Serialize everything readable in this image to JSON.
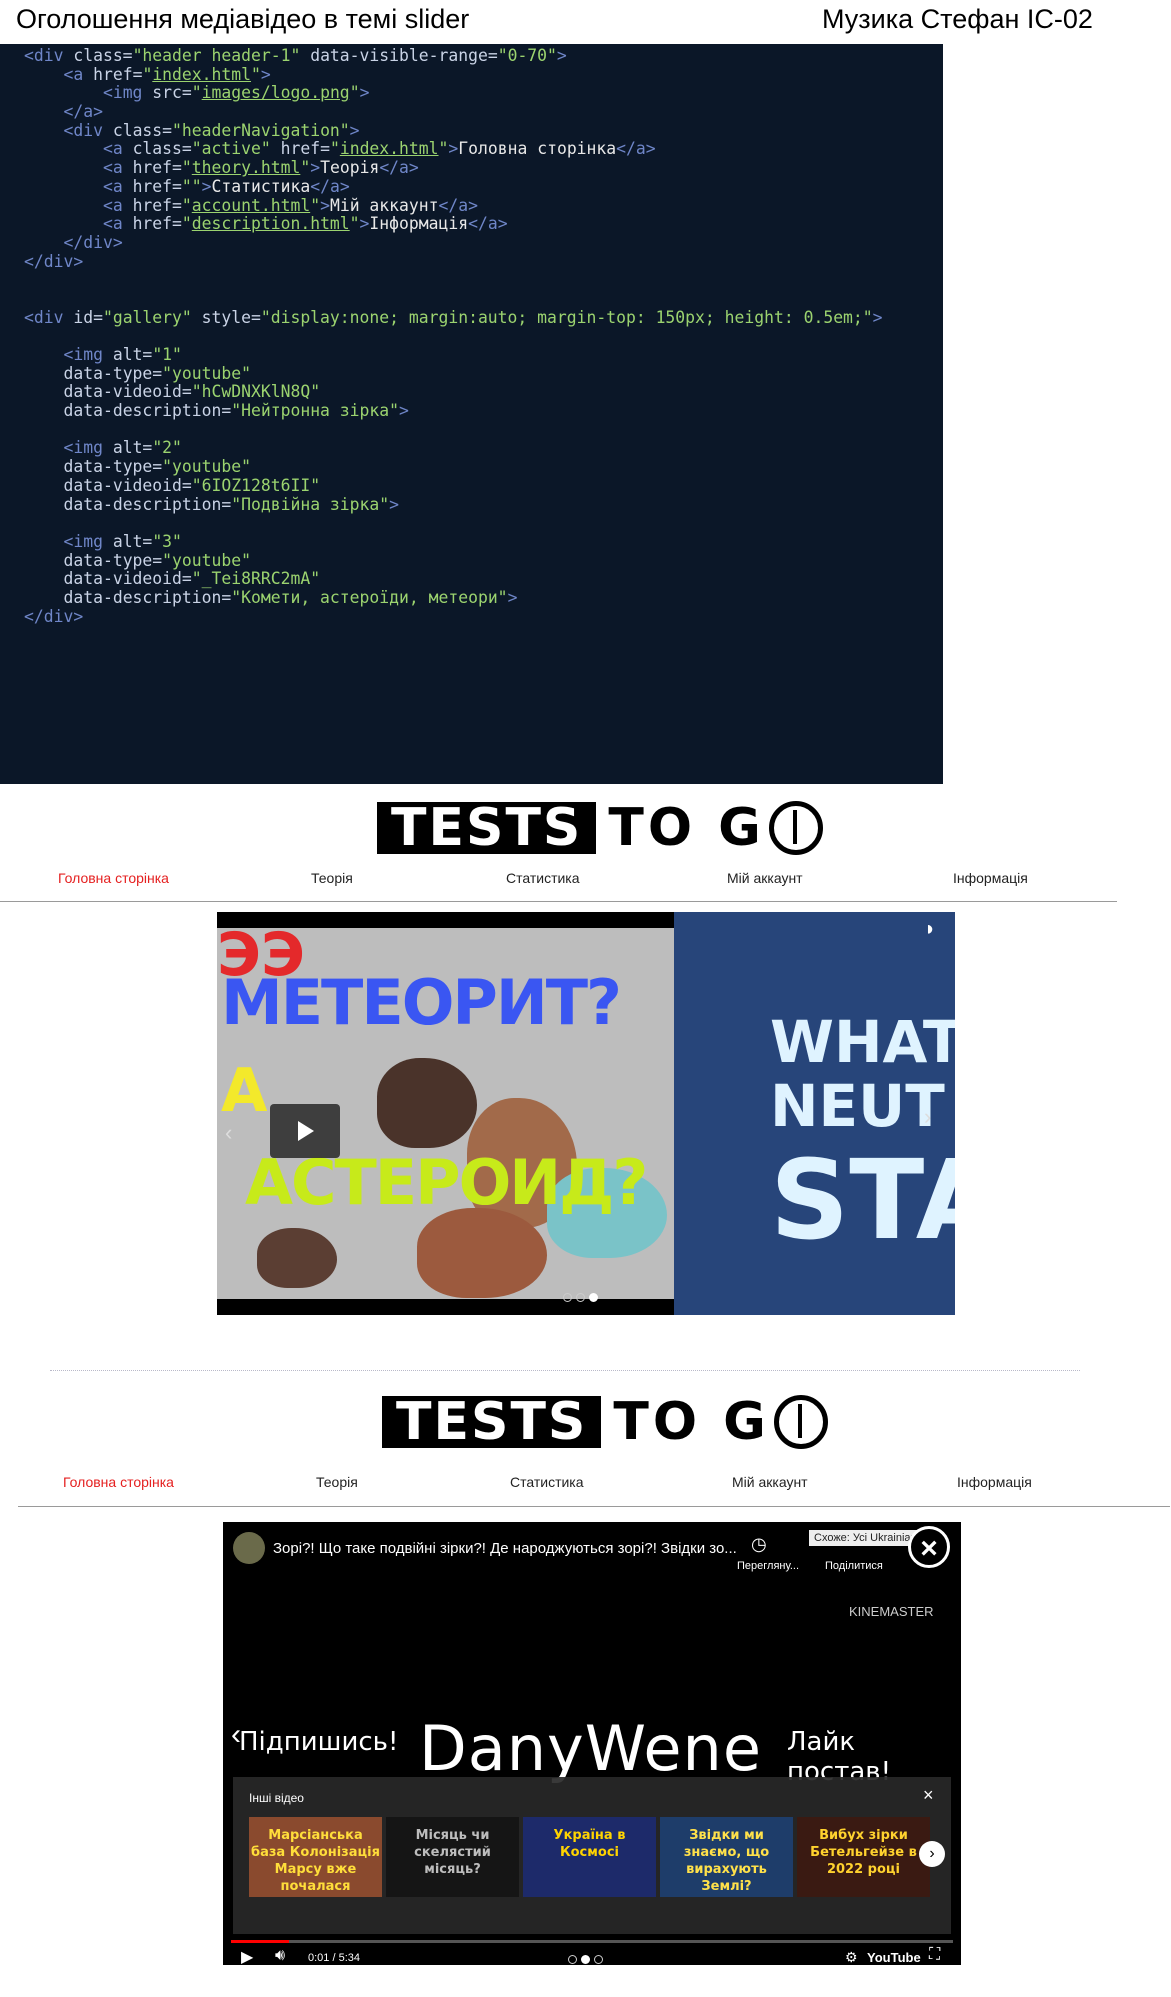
{
  "caption": {
    "title": "Оголошення медіавідео в темі slider",
    "author": "Музика Стефан",
    "group": "ІС-02"
  },
  "code": {
    "lines": [
      [
        [
          "tag",
          "<div "
        ],
        [
          "attr",
          "class="
        ],
        [
          "str",
          "\"header header-1\""
        ],
        [
          "attr",
          " data-visible-range="
        ],
        [
          "str",
          "\"0-70\""
        ],
        [
          "tag",
          ">"
        ]
      ],
      [
        [
          "txt",
          "    "
        ],
        [
          "tag",
          "<a "
        ],
        [
          "attr",
          "href="
        ],
        [
          "str",
          "\""
        ],
        [
          "link",
          "index.html"
        ],
        [
          "str",
          "\""
        ],
        [
          "tag",
          ">"
        ]
      ],
      [
        [
          "txt",
          "        "
        ],
        [
          "tag",
          "<img "
        ],
        [
          "attr",
          "src="
        ],
        [
          "str",
          "\""
        ],
        [
          "link",
          "images/logo.png"
        ],
        [
          "str",
          "\""
        ],
        [
          "tag",
          ">"
        ]
      ],
      [
        [
          "txt",
          "    "
        ],
        [
          "tag",
          "</a>"
        ]
      ],
      [
        [
          "txt",
          "    "
        ],
        [
          "tag",
          "<div "
        ],
        [
          "attr",
          "class="
        ],
        [
          "str",
          "\"headerNavigation\""
        ],
        [
          "tag",
          ">"
        ]
      ],
      [
        [
          "txt",
          "        "
        ],
        [
          "tag",
          "<a "
        ],
        [
          "attr",
          "class="
        ],
        [
          "str",
          "\"active\""
        ],
        [
          "attr",
          " href="
        ],
        [
          "str",
          "\""
        ],
        [
          "link",
          "index.html"
        ],
        [
          "str",
          "\""
        ],
        [
          "tag",
          ">"
        ],
        [
          "txt",
          "Головна сторінка"
        ],
        [
          "tag",
          "</a>"
        ]
      ],
      [
        [
          "txt",
          "        "
        ],
        [
          "tag",
          "<a "
        ],
        [
          "attr",
          "href="
        ],
        [
          "str",
          "\""
        ],
        [
          "link",
          "theory.html"
        ],
        [
          "str",
          "\""
        ],
        [
          "tag",
          ">"
        ],
        [
          "txt",
          "Теорія"
        ],
        [
          "tag",
          "</a>"
        ]
      ],
      [
        [
          "txt",
          "        "
        ],
        [
          "tag",
          "<a "
        ],
        [
          "attr",
          "href="
        ],
        [
          "str",
          "\"\""
        ],
        [
          "tag",
          ">"
        ],
        [
          "txt",
          "Статистика"
        ],
        [
          "tag",
          "</a>"
        ]
      ],
      [
        [
          "txt",
          "        "
        ],
        [
          "tag",
          "<a "
        ],
        [
          "attr",
          "href="
        ],
        [
          "str",
          "\""
        ],
        [
          "link",
          "account.html"
        ],
        [
          "str",
          "\""
        ],
        [
          "tag",
          ">"
        ],
        [
          "txt",
          "Мій аккаунт"
        ],
        [
          "tag",
          "</a>"
        ]
      ],
      [
        [
          "txt",
          "        "
        ],
        [
          "tag",
          "<a "
        ],
        [
          "attr",
          "href="
        ],
        [
          "str",
          "\""
        ],
        [
          "link",
          "description.html"
        ],
        [
          "str",
          "\""
        ],
        [
          "tag",
          ">"
        ],
        [
          "txt",
          "Інформація"
        ],
        [
          "tag",
          "</a>"
        ]
      ],
      [
        [
          "txt",
          "    "
        ],
        [
          "tag",
          "</div>"
        ]
      ],
      [
        [
          "tag",
          "</div>"
        ]
      ],
      [],
      [],
      [
        [
          "tag",
          "<div "
        ],
        [
          "attr",
          "id="
        ],
        [
          "str",
          "\"gallery\""
        ],
        [
          "attr",
          " style="
        ],
        [
          "str",
          "\"display:none; margin:auto; margin-top: 150px; height: 0.5em;\""
        ],
        [
          "tag",
          ">"
        ]
      ],
      [],
      [
        [
          "txt",
          "    "
        ],
        [
          "tag",
          "<img "
        ],
        [
          "attr",
          "alt="
        ],
        [
          "str",
          "\"1\""
        ]
      ],
      [
        [
          "txt",
          "    "
        ],
        [
          "attr",
          "data-type="
        ],
        [
          "str",
          "\"youtube\""
        ]
      ],
      [
        [
          "txt",
          "    "
        ],
        [
          "attr",
          "data-videoid="
        ],
        [
          "str",
          "\"hCwDNXKlN8Q\""
        ]
      ],
      [
        [
          "txt",
          "    "
        ],
        [
          "attr",
          "data-description="
        ],
        [
          "str",
          "\"Нейтронна зірка\""
        ],
        [
          "tag",
          ">"
        ]
      ],
      [],
      [
        [
          "txt",
          "    "
        ],
        [
          "tag",
          "<img "
        ],
        [
          "attr",
          "alt="
        ],
        [
          "str",
          "\"2\""
        ]
      ],
      [
        [
          "txt",
          "    "
        ],
        [
          "attr",
          "data-type="
        ],
        [
          "str",
          "\"youtube\""
        ]
      ],
      [
        [
          "txt",
          "    "
        ],
        [
          "attr",
          "data-videoid="
        ],
        [
          "str",
          "\"6IOZ128t6II\""
        ]
      ],
      [
        [
          "txt",
          "    "
        ],
        [
          "attr",
          "data-description="
        ],
        [
          "str",
          "\"Подвійна зірка\""
        ],
        [
          "tag",
          ">"
        ]
      ],
      [],
      [
        [
          "txt",
          "    "
        ],
        [
          "tag",
          "<img "
        ],
        [
          "attr",
          "alt="
        ],
        [
          "str",
          "\"3\""
        ]
      ],
      [
        [
          "txt",
          "    "
        ],
        [
          "attr",
          "data-type="
        ],
        [
          "str",
          "\"youtube\""
        ]
      ],
      [
        [
          "txt",
          "    "
        ],
        [
          "attr",
          "data-videoid="
        ],
        [
          "str",
          "\"_Tei8RRC2mA\""
        ]
      ],
      [
        [
          "txt",
          "    "
        ],
        [
          "attr",
          "data-description="
        ],
        [
          "str",
          "\"Комети, астероїди, метеори\""
        ],
        [
          "tag",
          ">"
        ]
      ],
      [
        [
          "tag",
          "</div>"
        ]
      ]
    ]
  },
  "site": {
    "logo_box": "TESTS",
    "logo_rest": "TO G",
    "nav": [
      "Головна сторінка",
      "Теорія",
      "Статистика",
      "Мій аккаунт",
      "Інформація"
    ]
  },
  "slider1": {
    "left_video": {
      "line1": "МЕТЕОРИТ?",
      "line2": "АСТЕРОИД?"
    },
    "right_video": {
      "line1": "WHAT",
      "line2": "NEUT",
      "line3": "STA"
    },
    "active_dot": 2
  },
  "slider2": {
    "video_title": "Зорі?! Що таке подвійні зірки?! Де народжуються зорі?! Звідки зо...",
    "watch_later": "Перегляну...",
    "share": "Поділитися",
    "tooltip": "Схоже: Усі Ukrainian...",
    "watermark": "KINEMASTER",
    "left_caption": "Підпишись!",
    "center_caption": "DanyWene",
    "right_caption": "Лайк постав!",
    "other_videos_title": "Інші відео",
    "thumbs": [
      {
        "text": "Марсіанська база Колонізація Марсу вже почалася",
        "bg": "#8a4a2e",
        "color": "#ffde3a"
      },
      {
        "text": "Місяць чи скелястий місяць?",
        "bg": "#151515",
        "color": "#bdbdbd"
      },
      {
        "text": "Україна в Космосі",
        "bg": "#1d2a6a",
        "color": "#ffd400"
      },
      {
        "text": "Звідки ми знаємо, що вирахують Землі?",
        "bg": "#1e3d6a",
        "color": "#ffe14a"
      },
      {
        "text": "Вибух зірки Бетельгейзе в 2022 році",
        "bg": "#3a1a12",
        "color": "#ffd22e"
      }
    ],
    "time": "0:01 / 5:34",
    "youtube_label": "YouTube",
    "active_dot": 1
  }
}
